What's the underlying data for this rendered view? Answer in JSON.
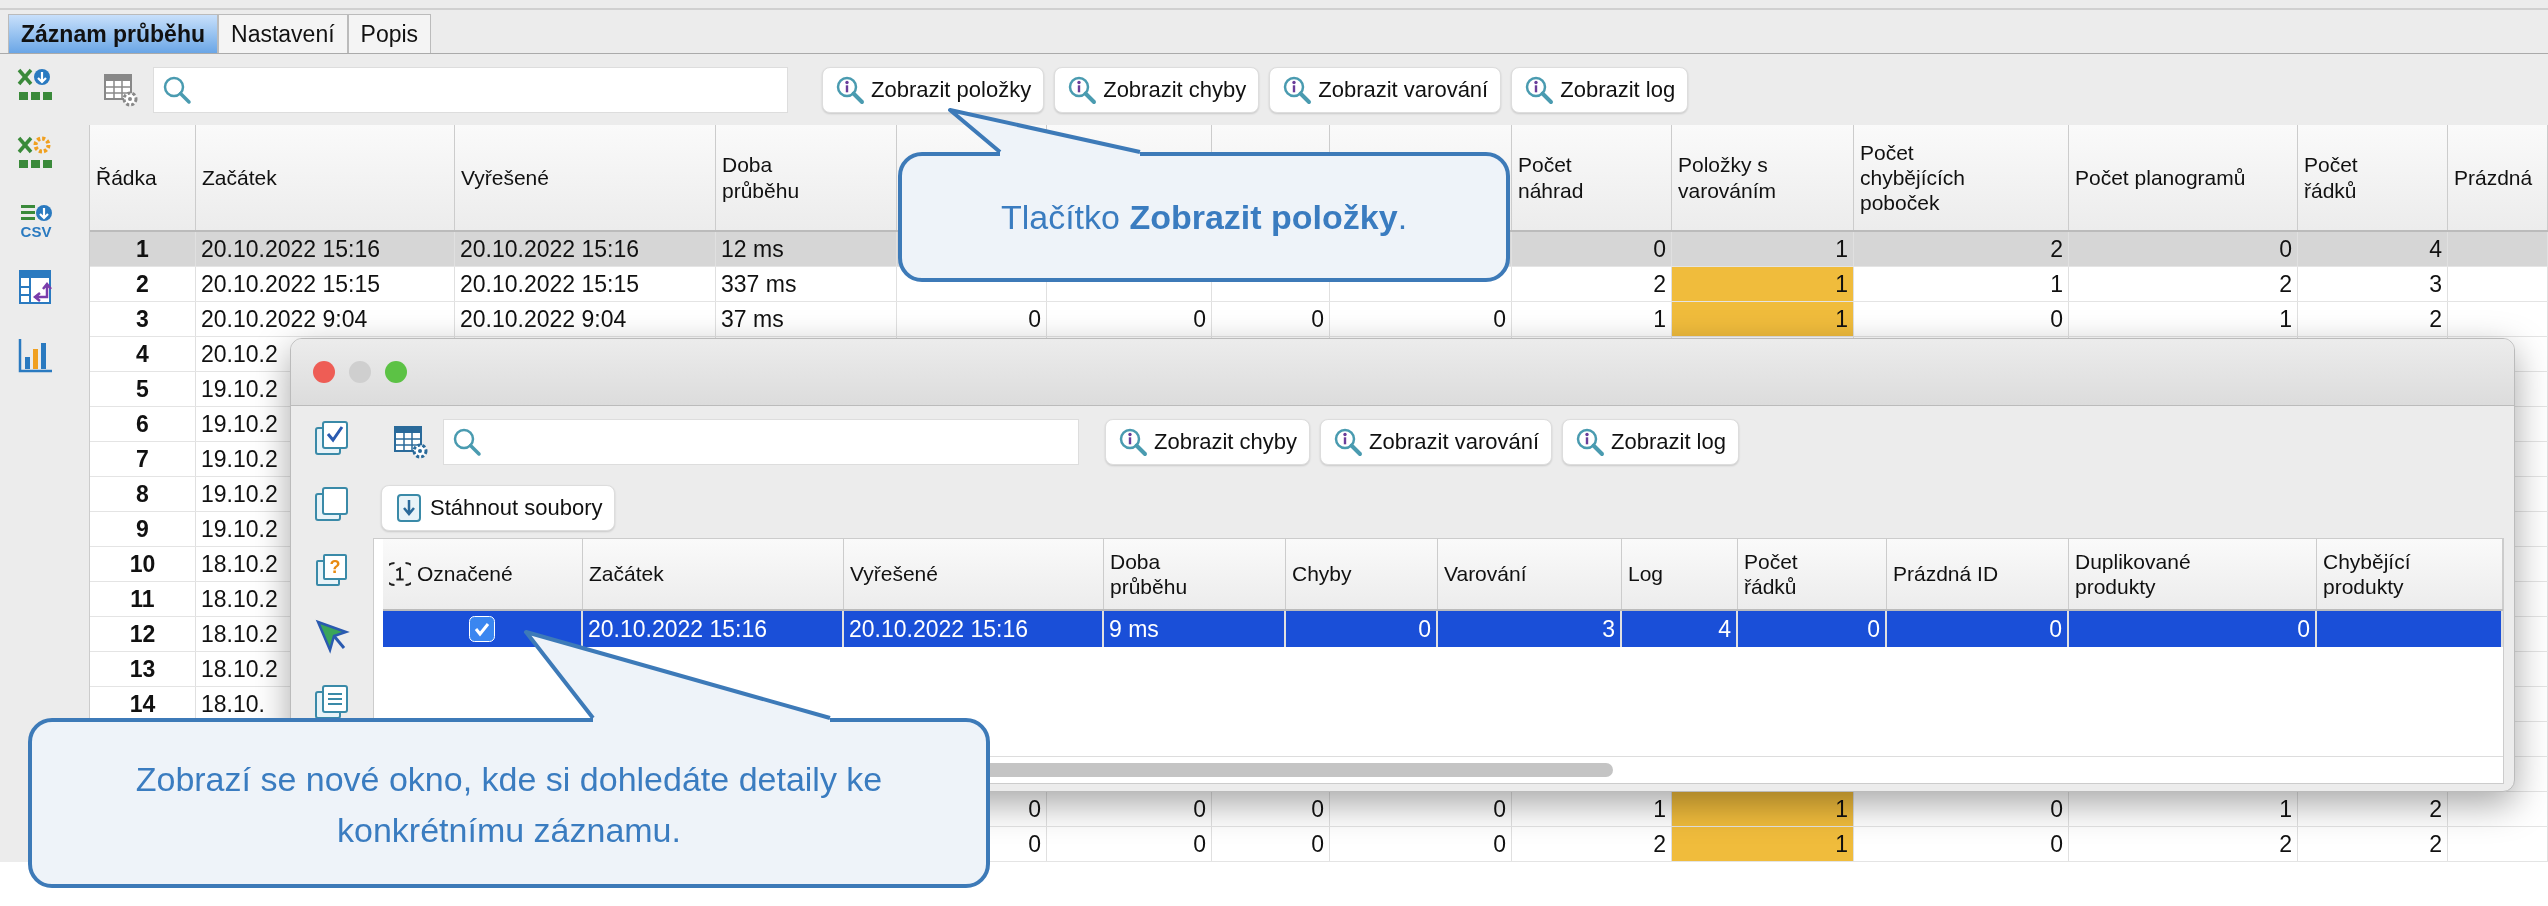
{
  "tabs": [
    {
      "label": "Záznam průběhu",
      "selected": true
    },
    {
      "label": "Nastavení",
      "selected": false
    },
    {
      "label": "Popis",
      "selected": false
    }
  ],
  "sidebar": [
    {
      "kind": "xls-export"
    },
    {
      "kind": "xls-settings"
    },
    {
      "kind": "csv-export",
      "label": "CSV"
    },
    {
      "kind": "table-transfer"
    },
    {
      "kind": "chart"
    }
  ],
  "toolbar_buttons": [
    "Zobrazit položky",
    "Zobrazit chyby",
    "Zobrazit varování",
    "Zobrazit log"
  ],
  "table": {
    "columns": [
      "Řádka",
      "Začátek",
      "Vyřešené",
      "Doba\nprůběhu",
      null,
      null,
      null,
      null,
      "Počet\nnáhrad",
      "Položky s\nvarováním",
      "Počet\nchybějících\npoboček",
      "Počet planogramů",
      "Počet\nřádků",
      "Prázdná"
    ],
    "rows": [
      {
        "selected": true,
        "cells": [
          "1",
          "20.10.2022 15:16",
          "20.10.2022 15:16",
          "12 ms",
          null,
          null,
          null,
          null,
          "0",
          "1",
          "2",
          "0",
          "4",
          null
        ]
      },
      {
        "selected": false,
        "cells": [
          "2",
          "20.10.2022 15:15",
          "20.10.2022 15:15",
          "337 ms",
          null,
          null,
          null,
          null,
          "2",
          {
            "text": "1",
            "highlighted": true
          },
          "1",
          "2",
          "3",
          null
        ]
      },
      {
        "selected": false,
        "cells": [
          "3",
          "20.10.2022 9:04",
          "20.10.2022 9:04",
          "37 ms",
          "0",
          "0",
          "0",
          "0",
          "1",
          {
            "text": "1",
            "highlighted": true
          },
          "0",
          "1",
          "2",
          null
        ]
      },
      {
        "selected": false,
        "cells": [
          "4",
          "20.10.2",
          null,
          null,
          null,
          null,
          null,
          null,
          null,
          null,
          null,
          null,
          null,
          null
        ]
      },
      {
        "selected": false,
        "cells": [
          "5",
          "19.10.2",
          null,
          null,
          null,
          null,
          null,
          null,
          null,
          null,
          null,
          null,
          null,
          null
        ]
      },
      {
        "selected": false,
        "cells": [
          "6",
          "19.10.2",
          null,
          null,
          null,
          null,
          null,
          null,
          null,
          null,
          null,
          null,
          null,
          null
        ]
      },
      {
        "selected": false,
        "cells": [
          "7",
          "19.10.2",
          null,
          null,
          null,
          null,
          null,
          null,
          null,
          null,
          null,
          null,
          null,
          null
        ]
      },
      {
        "selected": false,
        "cells": [
          "8",
          "19.10.2",
          null,
          null,
          null,
          null,
          null,
          null,
          null,
          null,
          null,
          null,
          null,
          null
        ]
      },
      {
        "selected": false,
        "cells": [
          "9",
          "19.10.2",
          null,
          null,
          null,
          null,
          null,
          null,
          null,
          null,
          null,
          null,
          null,
          null
        ]
      },
      {
        "selected": false,
        "cells": [
          "10",
          "18.10.2",
          null,
          null,
          null,
          null,
          null,
          null,
          null,
          null,
          null,
          null,
          null,
          null
        ]
      },
      {
        "selected": false,
        "cells": [
          "11",
          "18.10.2",
          null,
          null,
          null,
          null,
          null,
          null,
          null,
          null,
          null,
          null,
          null,
          null
        ]
      },
      {
        "selected": false,
        "cells": [
          "12",
          "18.10.2",
          null,
          null,
          null,
          null,
          null,
          null,
          null,
          null,
          null,
          null,
          null,
          null
        ]
      },
      {
        "selected": false,
        "cells": [
          "13",
          "18.10.2",
          null,
          null,
          null,
          null,
          null,
          null,
          null,
          null,
          null,
          null,
          null,
          null
        ]
      },
      {
        "selected": false,
        "cells": [
          "14",
          "18.10.",
          null,
          null,
          null,
          null,
          null,
          null,
          null,
          null,
          null,
          null,
          null,
          null
        ]
      },
      {
        "selected": false,
        "cells": [
          null,
          null,
          null,
          null,
          null,
          null,
          null,
          null,
          null,
          null,
          null,
          null,
          null,
          null
        ]
      },
      {
        "selected": false,
        "cells": [
          null,
          null,
          null,
          null,
          null,
          null,
          null,
          null,
          null,
          null,
          null,
          null,
          null,
          null
        ]
      },
      {
        "selected": false,
        "cells": [
          null,
          null,
          null,
          null,
          "0",
          "0",
          "0",
          "0",
          "1",
          {
            "text": "1",
            "highlighted": true
          },
          "0",
          "1",
          "2",
          null
        ]
      },
      {
        "selected": false,
        "cells": [
          null,
          null,
          null,
          null,
          "0",
          "0",
          "0",
          "0",
          "2",
          {
            "text": "1",
            "highlighted": true
          },
          "0",
          "2",
          "2",
          null
        ]
      }
    ]
  },
  "dialog": {
    "sidebar": [
      {
        "kind": "check-stack"
      },
      {
        "kind": "stack"
      },
      {
        "kind": "question-stack",
        "label": "?"
      },
      {
        "kind": "cursor"
      },
      {
        "kind": "doc-stack"
      }
    ],
    "toolbar_buttons": [
      "Zobrazit chyby",
      "Zobrazit varování",
      "Zobrazit log"
    ],
    "download_button": "Stáhnout soubory",
    "table": {
      "columns": [
        "Označené",
        "Začátek",
        "Vyřešené",
        "Doba\nprůběhu",
        "Chyby",
        "Varování",
        "Log",
        "Počet\nřádků",
        "Prázdná ID",
        "Duplikované\nprodukty",
        "Chybějící\nprodukty"
      ],
      "rows": [
        {
          "selected": true,
          "checked": true,
          "cells": [
            "",
            "20.10.2022 15:16",
            "20.10.2022 15:16",
            "9 ms",
            "0",
            "3",
            "4",
            "0",
            "0",
            "0",
            null
          ]
        }
      ]
    }
  },
  "callouts": [
    {
      "text": "Tlačítko **Zobrazit položky**."
    },
    {
      "text": "Zobrazí se nové okno, kde si dohledáte detaily ke konkrétnímu záznamu."
    }
  ]
}
